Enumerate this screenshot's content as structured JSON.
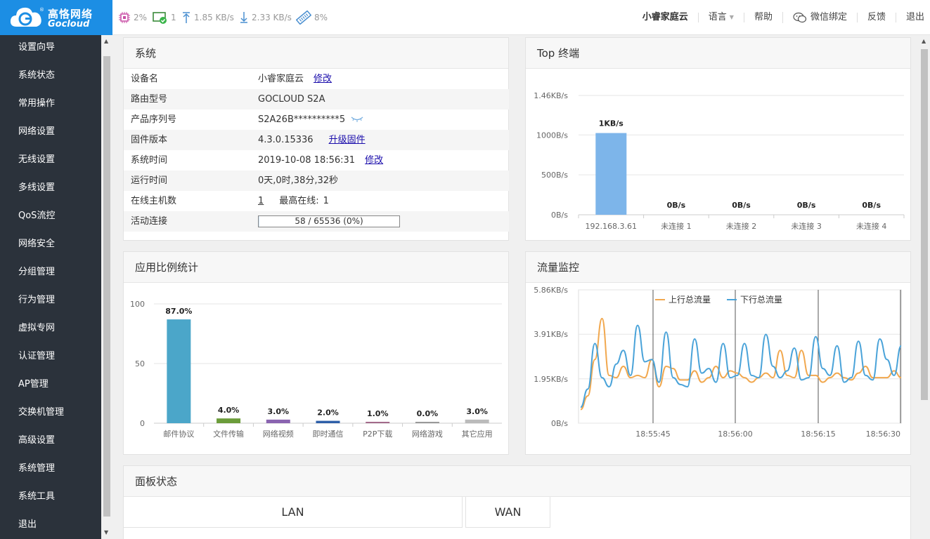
{
  "header": {
    "brand_cn": "高恪网络",
    "brand_en": "Gocloud",
    "brand_reg": "®",
    "stats": {
      "cpu": "2%",
      "hosts": "1",
      "upload": "1.85 KB/s",
      "download": "2.33 KB/s",
      "memory": "8%"
    },
    "nav": {
      "device": "小睿家庭云",
      "language": "语言",
      "help": "帮助",
      "wechat": "微信绑定",
      "feedback": "反馈",
      "logout": "退出"
    }
  },
  "sidebar": {
    "items": [
      "设置向导",
      "系统状态",
      "常用操作",
      "网络设置",
      "无线设置",
      "多线设置",
      "QoS流控",
      "网络安全",
      "分组管理",
      "行为管理",
      "虚拟专网",
      "认证管理",
      "AP管理",
      "交换机管理",
      "高级设置",
      "系统管理",
      "系统工具",
      "退出"
    ]
  },
  "system_panel": {
    "title": "系统",
    "rows": {
      "device_name": {
        "label": "设备名",
        "value": "小睿家庭云",
        "action": "修改"
      },
      "model": {
        "label": "路由型号",
        "value": "GOCLOUD S2A"
      },
      "serial": {
        "label": "产品序列号",
        "value": "S2A26B**********5"
      },
      "firmware": {
        "label": "固件版本",
        "value": "4.3.0.15336",
        "action": "升级固件"
      },
      "time": {
        "label": "系统时间",
        "value": "2019-10-08 18:56:31",
        "action": "修改"
      },
      "uptime": {
        "label": "运行时间",
        "value": "0天,0时,38分,32秒"
      },
      "hosts": {
        "label": "在线主机数",
        "value": "1",
        "max_label": "最高在线:",
        "max_value": "1"
      },
      "connections": {
        "label": "活动连接",
        "value": "58 / 65536 (0%)",
        "ratio": 0.0009
      }
    }
  },
  "top_panel": {
    "title": "Top 终端"
  },
  "app_panel": {
    "title": "应用比例统计"
  },
  "traffic_panel": {
    "title": "流量监控"
  },
  "ports_panel": {
    "title": "面板状态",
    "lan": "LAN",
    "wan": "WAN"
  },
  "colors": {
    "accent": "#1c8ee4",
    "sidebar": "#2b323b",
    "bar_blue": "#7db5ea",
    "upload_line": "#f1a84f",
    "download_line": "#4aa3d9"
  },
  "chart_data": [
    {
      "type": "bar",
      "title": "Top 终端",
      "categories": [
        "192.168.3.61",
        "未连接 1",
        "未连接 2",
        "未连接 3",
        "未连接 4"
      ],
      "values": [
        1024,
        0,
        0,
        0,
        0
      ],
      "data_labels": [
        "1KB/s",
        "0B/s",
        "0B/s",
        "0B/s",
        "0B/s"
      ],
      "yticks": [
        0,
        500,
        1000,
        1495
      ],
      "ytick_labels": [
        "0B/s",
        "500B/s",
        "1000B/s",
        "1.46KB/s"
      ],
      "ylim": [
        0,
        1495
      ],
      "grid": true
    },
    {
      "type": "bar",
      "title": "应用比例统计",
      "categories": [
        "邮件协议",
        "文件传输",
        "网络视频",
        "即时通信",
        "P2P下载",
        "网络游戏",
        "其它应用"
      ],
      "values": [
        87.0,
        4.0,
        3.0,
        2.0,
        1.0,
        0.0,
        3.0
      ],
      "data_labels": [
        "87.0%",
        "4.0%",
        "3.0%",
        "2.0%",
        "1.0%",
        "0.0%",
        "3.0%"
      ],
      "colors": [
        "#4ba6c9",
        "#6b9c3a",
        "#8a64b0",
        "#2e5fa8",
        "#a36a8a",
        "#999999",
        "#bbbbbb"
      ],
      "yticks": [
        0,
        50,
        100
      ],
      "ylim": [
        0,
        100
      ],
      "grid": true
    },
    {
      "type": "line",
      "title": "流量监控",
      "ylabel": "",
      "yticks": [
        0,
        1.95,
        3.91,
        5.86
      ],
      "ytick_labels": [
        "0B/s",
        "1.95KB/s",
        "3.91KB/s",
        "5.86KB/s"
      ],
      "ylim": [
        0,
        5.86
      ],
      "x_ticks": [
        "18:55:45",
        "18:56:00",
        "18:56:15",
        "18:56:30"
      ],
      "legend_position": "top",
      "series": [
        {
          "name": "上行总流量",
          "values": [
            0.6,
            1.2,
            2.8,
            4.6,
            2.1,
            2.0,
            2.5,
            2.0,
            2.1,
            2.0,
            2.8,
            1.6,
            2.5,
            2.4,
            1.9,
            1.9,
            2.3,
            1.8,
            2.0,
            2.5,
            2.0,
            2.3,
            2.2,
            2.0,
            1.8,
            2.0,
            2.2,
            2.0,
            3.2,
            2.1,
            2.0,
            3.2,
            2.1,
            2.1,
            1.8,
            2.0,
            2.2,
            2.0,
            1.9,
            2.2,
            2.5,
            2.0,
            2.0,
            2.0,
            2.3,
            2.0
          ]
        },
        {
          "name": "下行总流量",
          "values": [
            0.7,
            1.5,
            3.5,
            2.0,
            1.6,
            2.6,
            3.2,
            2.1,
            4.3,
            2.7,
            2.8,
            1.8,
            4.0,
            2.0,
            1.7,
            1.6,
            3.7,
            2.2,
            2.4,
            1.8,
            3.5,
            2.0,
            2.1,
            3.5,
            2.1,
            2.0,
            3.9,
            2.5,
            2.0,
            2.3,
            3.3,
            1.9,
            2.0,
            3.8,
            2.4,
            2.1,
            3.4,
            1.8,
            2.0,
            3.6,
            2.1,
            1.9,
            3.7,
            2.8,
            2.1,
            3.4
          ]
        }
      ]
    }
  ]
}
